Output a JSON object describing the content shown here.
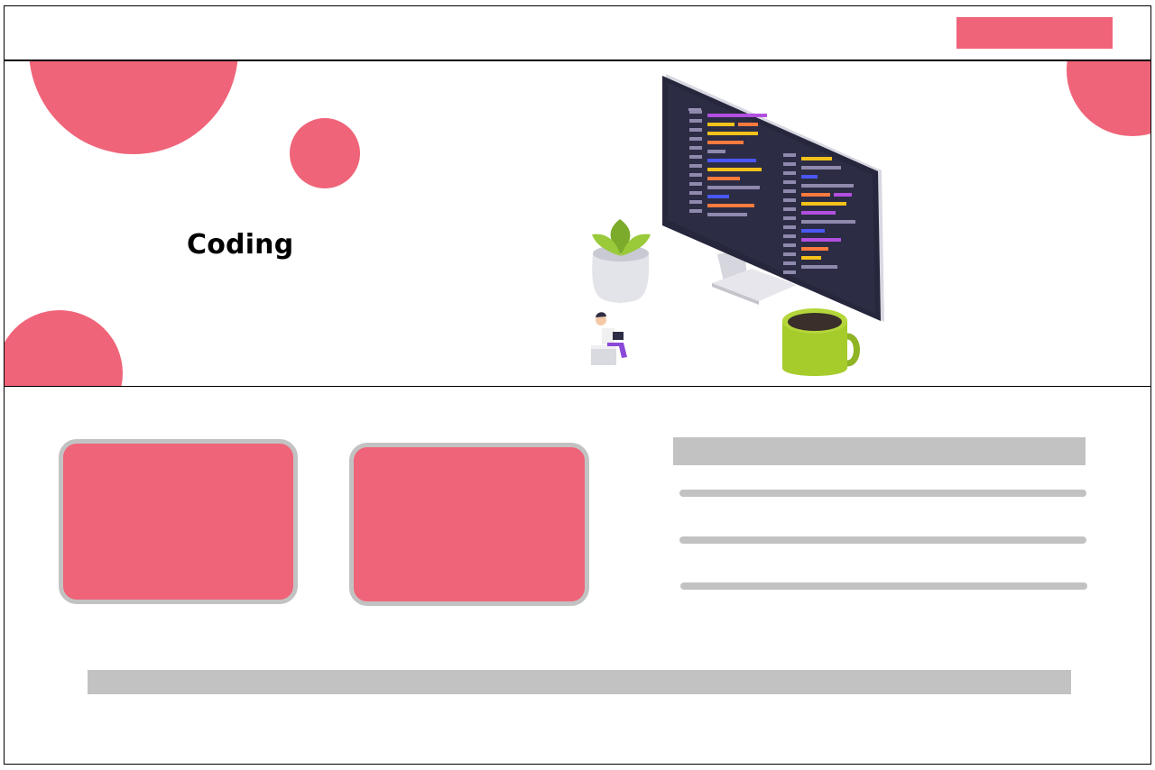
{
  "navbar": {
    "action_button_label": "",
    "accent_color": "#ef6479"
  },
  "hero": {
    "title": "Coding",
    "illustration": "developer-workspace-illustration",
    "decoration_color": "#ef6479"
  },
  "content": {
    "cards": [
      {
        "label": ""
      },
      {
        "label": ""
      }
    ],
    "heading_placeholder": "",
    "text_lines": [
      "",
      "",
      ""
    ],
    "footer_placeholder": "",
    "placeholder_color": "#c2c2c2"
  }
}
